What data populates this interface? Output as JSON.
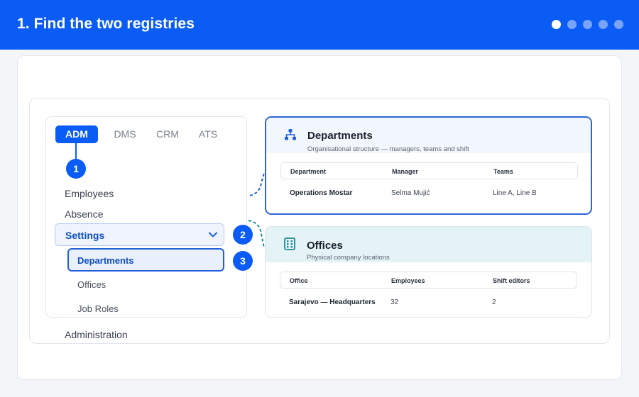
{
  "header": {
    "title": "1. Find the two registries",
    "progress": {
      "current": 1,
      "total": 5
    }
  },
  "nav": {
    "tabs": [
      {
        "label": "ADM",
        "active": true
      },
      {
        "label": "DMS",
        "active": false
      },
      {
        "label": "CRM",
        "active": false
      },
      {
        "label": "ATS",
        "active": false
      }
    ],
    "items": {
      "employees": "Employees",
      "absence": "Absence",
      "settings": "Settings",
      "departments": "Departments",
      "offices": "Offices",
      "job_roles": "Job Roles",
      "administration": "Administration"
    }
  },
  "steps": {
    "one": "1",
    "two": "2",
    "three": "3"
  },
  "departments_card": {
    "title": "Departments",
    "subtitle": "Organisational structure — managers, teams and shift",
    "columns": [
      "Department",
      "Manager",
      "Teams"
    ],
    "rows": [
      [
        "Operations Mostar",
        "Selma Mujić",
        "Line A, Line B"
      ]
    ]
  },
  "offices_card": {
    "title": "Offices",
    "subtitle": "Physical company locations",
    "columns": [
      "Office",
      "Employees",
      "Shift editors"
    ],
    "rows": [
      [
        "Sarajevo — Headquarters",
        "32",
        "2"
      ]
    ]
  },
  "colors": {
    "accent": "#0b5cf5",
    "offices_icon": "#1a8a9a"
  },
  "icons": {
    "departments": "org-chart-icon",
    "offices": "building-icon",
    "settings_toggle": "chevron-down-icon"
  }
}
